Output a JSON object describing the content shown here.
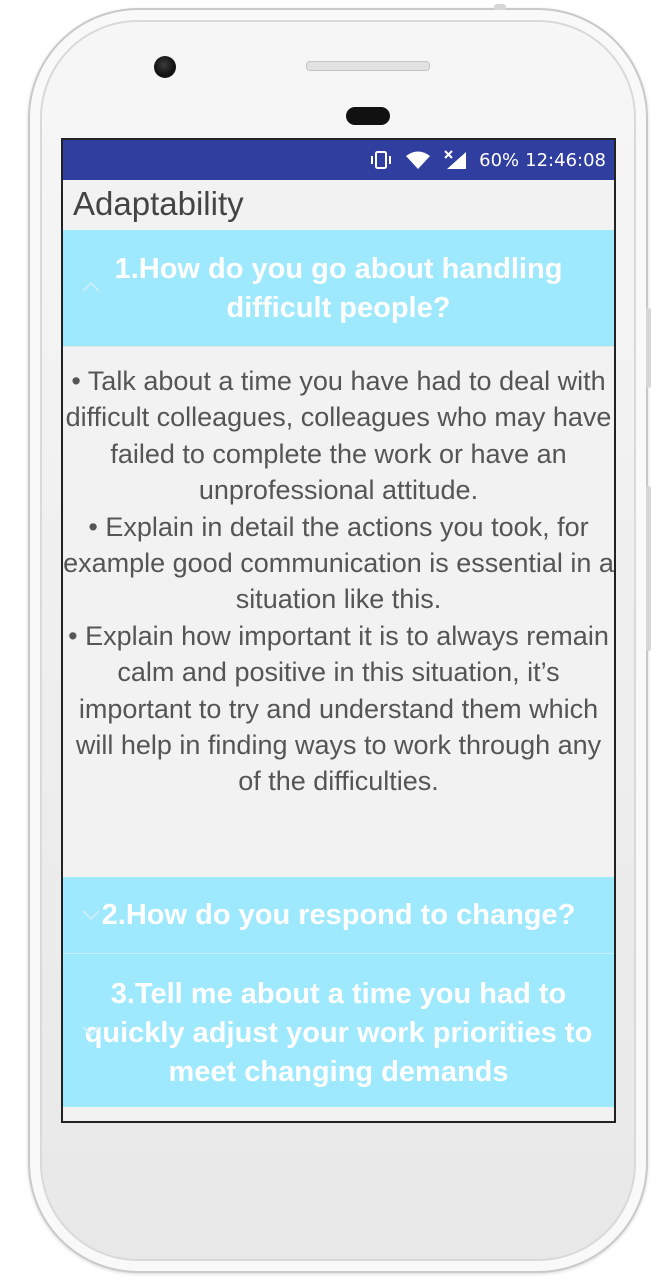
{
  "status_bar": {
    "battery": "60%",
    "time": "12:46:08",
    "icons": [
      "vibrate-icon",
      "wifi-icon",
      "signal-icon"
    ]
  },
  "app": {
    "title": "Adaptability"
  },
  "questions": [
    {
      "title": "1.How do you go about handling difficult people?",
      "expanded": true,
      "answer": [
        "• Talk about a time you have had to deal with difficult colleagues, colleagues who may have failed to complete the work or have an unprofessional attitude.",
        "• Explain in detail the actions you took, for example good communication is essential in a situation like this.",
        "• Explain how important it is to always remain calm and positive in this situation, it’s important to try and understand them which will help in finding ways to work through any of the difficulties."
      ]
    },
    {
      "title": "2.How do you respond to change?",
      "expanded": false
    },
    {
      "title": "3.Tell me about a time you had to quickly adjust your work priorities to meet changing demands",
      "expanded": false
    }
  ],
  "colors": {
    "status_bar": "#303f9f",
    "question_header": "#9ee9fd",
    "screen_bg": "#f2f2f2"
  }
}
